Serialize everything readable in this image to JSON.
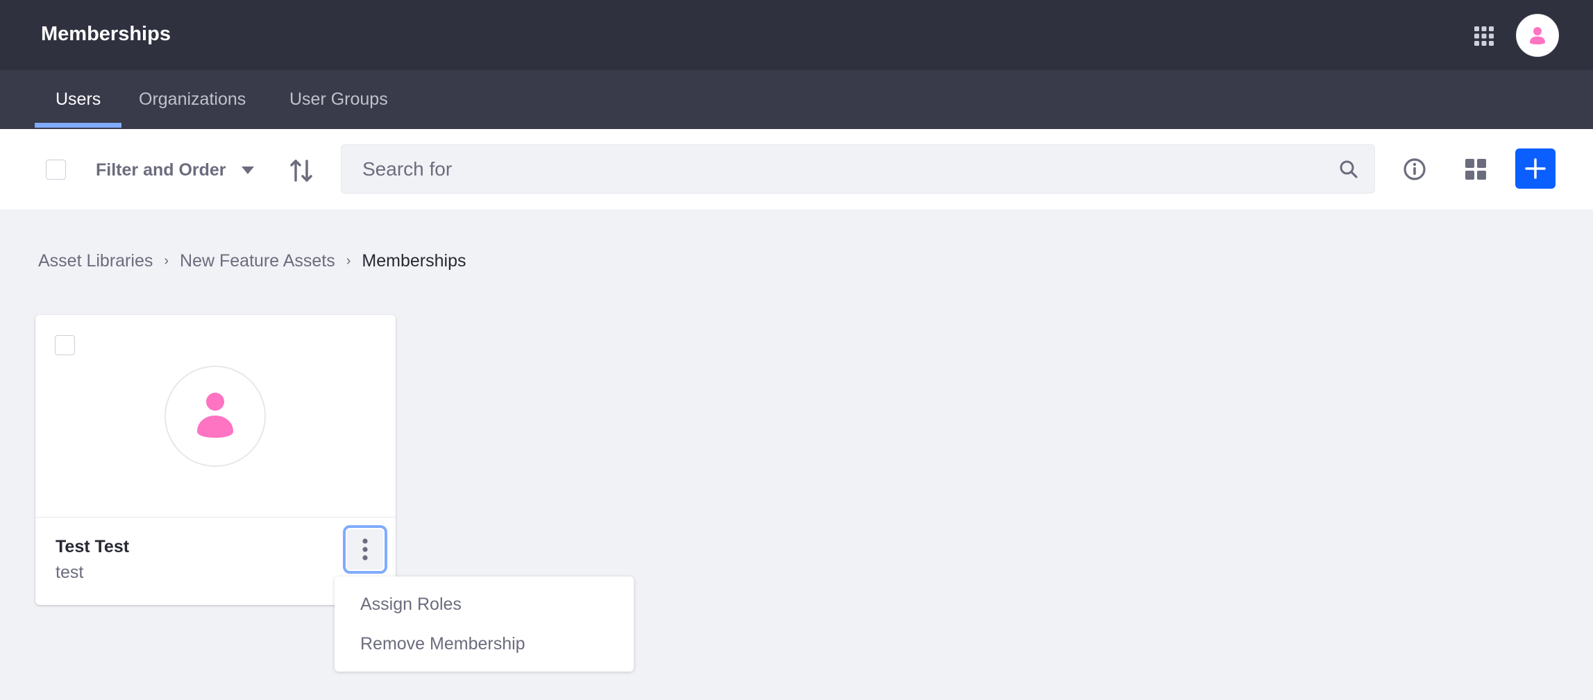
{
  "header": {
    "title": "Memberships",
    "apps_icon": "grid-3x3-icon",
    "user_avatar_icon": "user-icon"
  },
  "nav": {
    "tabs": [
      {
        "label": "Users",
        "active": true
      },
      {
        "label": "Organizations",
        "active": false
      },
      {
        "label": "User Groups",
        "active": false
      }
    ]
  },
  "toolbar": {
    "filter_label": "Filter and Order",
    "search_placeholder": "Search for",
    "search_value": "",
    "icons": {
      "sort": "order-arrows-icon",
      "search": "search-icon",
      "info": "info-circle-icon",
      "view": "cards-view-icon",
      "add": "plus-icon"
    }
  },
  "breadcrumb": {
    "items": [
      {
        "label": "Asset Libraries"
      },
      {
        "label": "New Feature Assets"
      },
      {
        "label": "Memberships"
      }
    ]
  },
  "cards": [
    {
      "title": "Test Test",
      "subtitle": "test",
      "checked": false
    }
  ],
  "dropdown": {
    "items": [
      {
        "label": "Assign Roles"
      },
      {
        "label": "Remove Membership"
      }
    ]
  },
  "colors": {
    "topbar": "#30313f",
    "navbar": "#393a4a",
    "active_tab_indicator": "#80acff",
    "primary": "#0b5fff",
    "avatar_icon": "#ff73c3",
    "muted_text": "#6b6c7e"
  }
}
